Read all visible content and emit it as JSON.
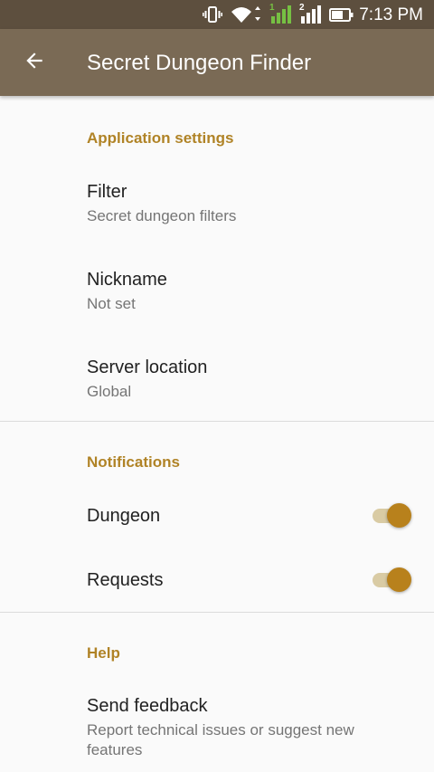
{
  "status_bar": {
    "time": "7:13 PM",
    "icons": [
      "vibrate-icon",
      "wifi-icon",
      "sim1-signal-icon",
      "sim2-signal-icon",
      "battery-icon"
    ],
    "sim1_label": "1",
    "sim2_label": "2"
  },
  "app_bar": {
    "title": "Secret Dungeon Finder",
    "back_icon": "arrow-left-icon"
  },
  "colors": {
    "status_bar": "#5d4f3e",
    "app_bar": "#7a6a55",
    "accent": "#b08326",
    "signal_active": "#76c043"
  },
  "sections": {
    "application": {
      "header": "Application settings",
      "filter": {
        "title": "Filter",
        "summary": "Secret dungeon filters"
      },
      "nickname": {
        "title": "Nickname",
        "summary": "Not set"
      },
      "server": {
        "title": "Server location",
        "summary": "Global"
      }
    },
    "notifications": {
      "header": "Notifications",
      "dungeon": {
        "title": "Dungeon",
        "enabled": true
      },
      "requests": {
        "title": "Requests",
        "enabled": true
      }
    },
    "help": {
      "header": "Help",
      "feedback": {
        "title": "Send feedback",
        "summary": "Report technical issues or suggest new features"
      }
    }
  }
}
